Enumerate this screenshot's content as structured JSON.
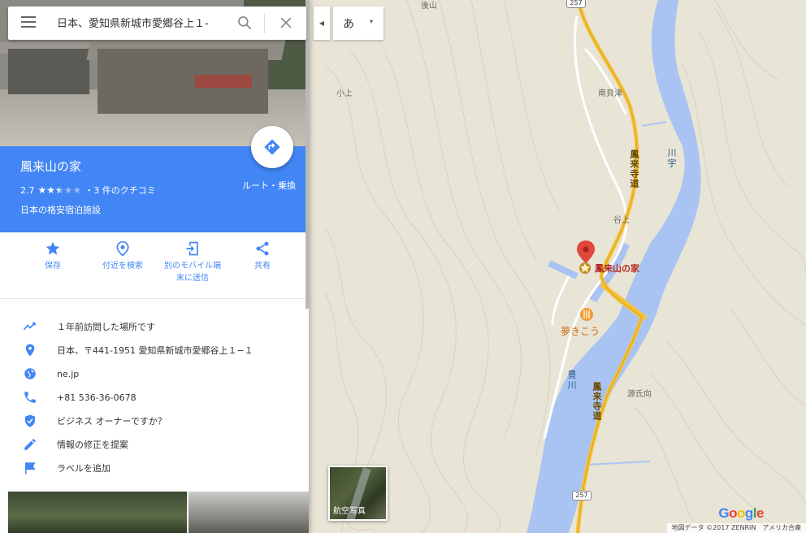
{
  "search": {
    "query": "日本、愛知県新城市愛郷谷上１-",
    "menu_icon": "hamburger-menu-icon",
    "search_icon": "magnifier-icon",
    "close_icon": "close-icon"
  },
  "panel_toggle_icon": "triangle-left-icon",
  "ime": {
    "char": "あ",
    "arrow": "▾"
  },
  "place": {
    "name": "鳳来山の家",
    "rating": "2.7",
    "stars_filled": 2.5,
    "stars_total": 5,
    "reviews": "・3 件のクチコミ",
    "type": "日本の格安宿泊施設",
    "route_label": "ルート・乗換"
  },
  "actions": [
    {
      "label": "保存",
      "icon": "star-icon"
    },
    {
      "label": "付近を検索",
      "icon": "nearby-icon"
    },
    {
      "label": "別のモバイル端\n末に送信",
      "label_line1": "別のモバイル端",
      "label_line2": "末に送信",
      "icon": "send-to-device-icon"
    },
    {
      "label": "共有",
      "icon": "share-icon"
    }
  ],
  "info": {
    "visited": "１年前訪問した場所です",
    "address": "日本、〒441-1951 愛知県新城市愛郷谷上１−１",
    "website": "ne.jp",
    "phone": "+81 536-36-0678",
    "owner": "ビジネス オーナーですか？",
    "suggest_edit": "情報の修正を提案",
    "add_label": "ラベルを追加"
  },
  "map": {
    "labels": {
      "ushiroyama": "後山",
      "kokami": "小上",
      "minami_kaizu": "南貝津",
      "taniue": "谷上",
      "genjimukai": "源氏向",
      "road_north": "鳳来寺道",
      "road_south": "鳳来寺道",
      "river_north": "川宇",
      "river_south": "豊川"
    },
    "route_shield_top": "257",
    "route_shield_bottom": "257",
    "poi_main": "鳳来山の家",
    "poi_food": "夢きこう",
    "satellite_label": "航空写真",
    "google_logo": [
      "G",
      "o",
      "o",
      "g",
      "l",
      "e"
    ],
    "attribution": "地図データ ©2017 ZENRIN　アメリカ合衆"
  },
  "colors": {
    "accent": "#4285f4",
    "map_bg": "#e8e4d6",
    "river": "#a9c4f2",
    "road": "#f5c33b",
    "marker": "#e0463a"
  }
}
